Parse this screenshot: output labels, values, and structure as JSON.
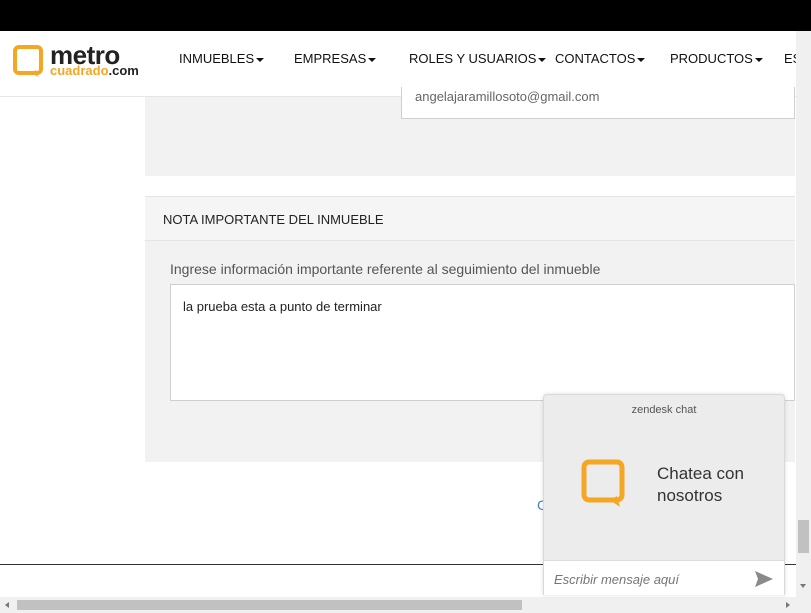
{
  "brand": {
    "logo_line1": "metro",
    "logo_line2_main": "cuadrado",
    "logo_line2_suffix": ".com",
    "accent": "#f5a623"
  },
  "nav": {
    "items": [
      {
        "label": "INMUEBLES"
      },
      {
        "label": "EMPRESAS"
      },
      {
        "label": "ROLES Y USUARIOS"
      },
      {
        "label": "CONTACTOS"
      },
      {
        "label": "PRODUCTOS"
      },
      {
        "label": "ES"
      }
    ]
  },
  "contact": {
    "email": "angelajaramillosoto@gmail.com"
  },
  "note_section": {
    "title": "NOTA IMPORTANTE DEL INMUEBLE",
    "field_label": "Ingrese información importante referente al seguimiento del inmueble",
    "field_value": "la prueba esta a punto de terminar"
  },
  "partial_link": "C",
  "chat": {
    "brand": "zendesk chat",
    "headline": "Chatea con nosotros",
    "input_placeholder": "Escribir mensaje aquí",
    "icon": "chat-bubble-icon",
    "send_icon": "send-icon"
  }
}
